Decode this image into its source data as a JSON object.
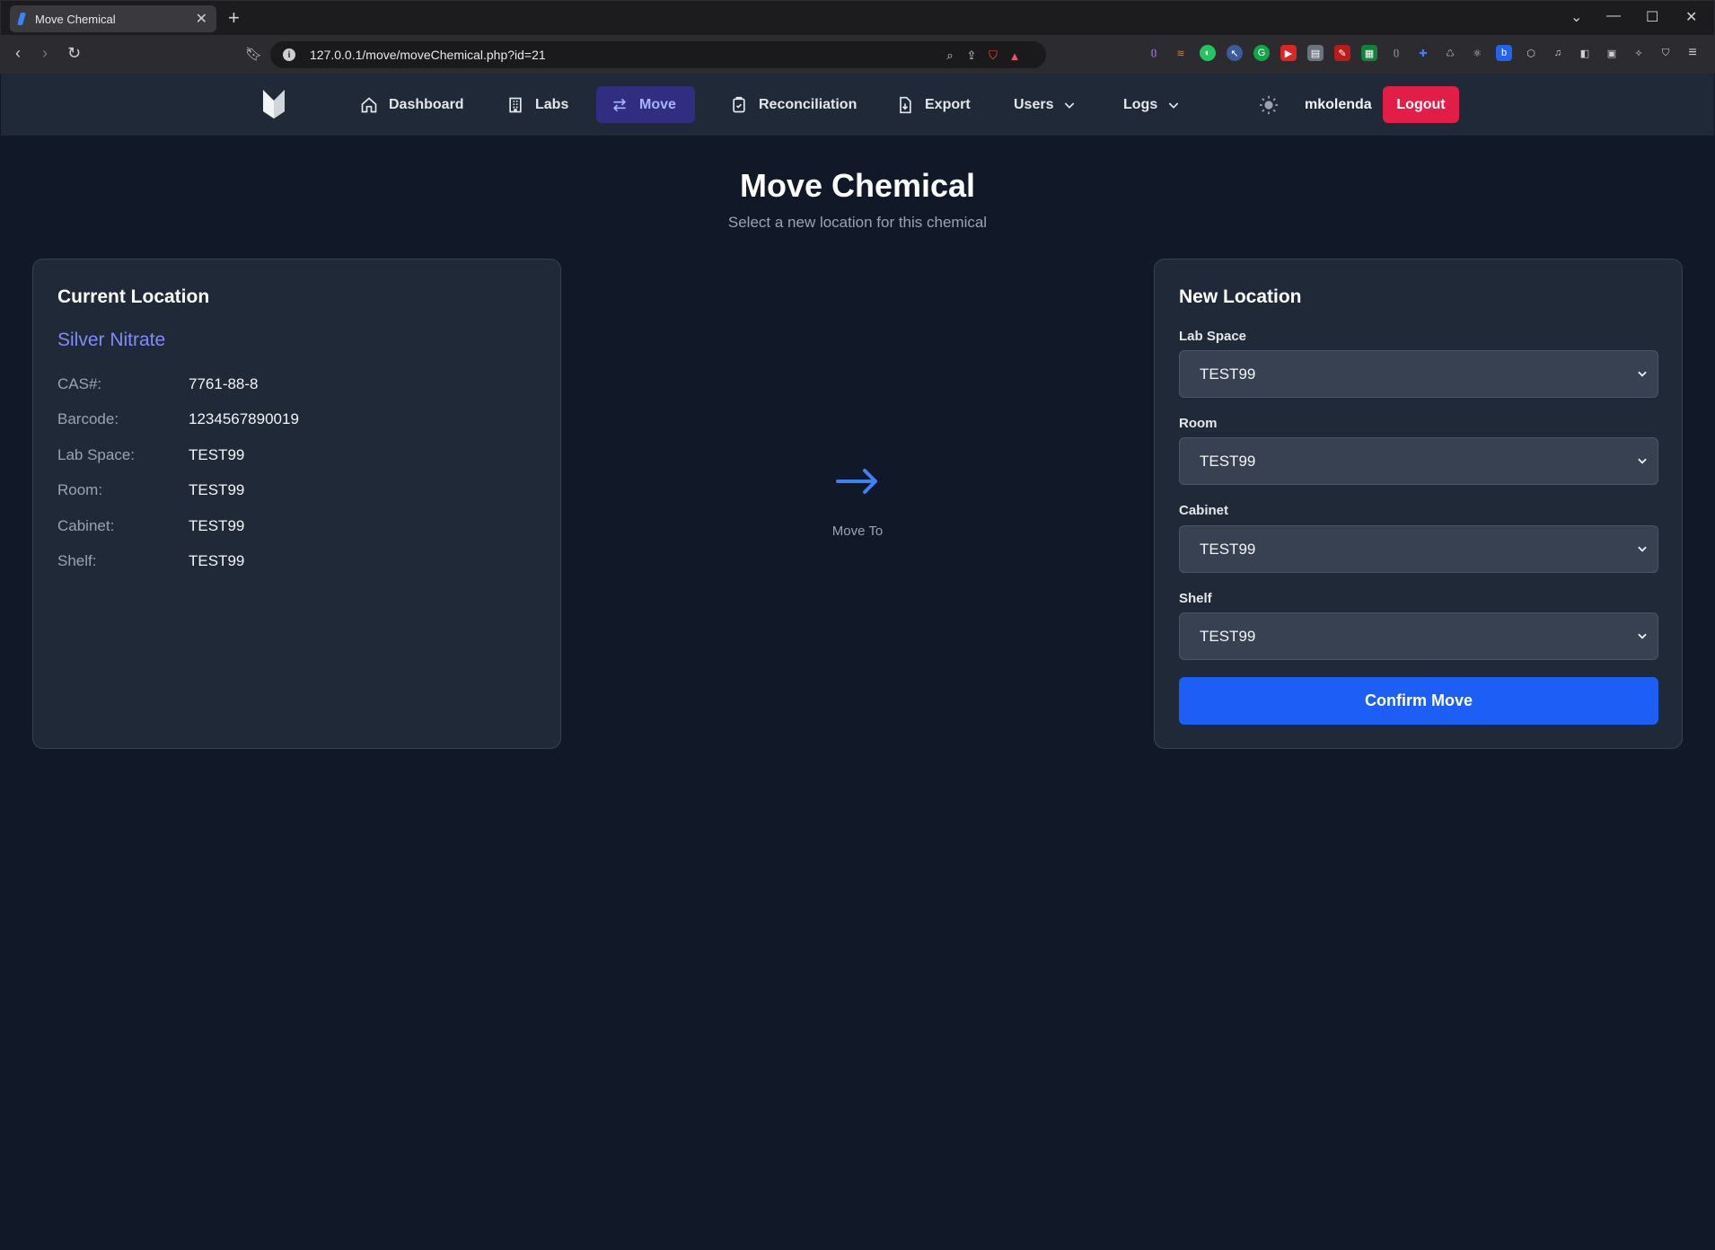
{
  "browser": {
    "tab_title": "Move Chemical",
    "url": "127.0.0.1/move/moveChemical.php?id=21"
  },
  "nav": {
    "items": [
      {
        "label": "Dashboard"
      },
      {
        "label": "Labs"
      },
      {
        "label": "Move"
      },
      {
        "label": "Reconciliation"
      },
      {
        "label": "Export"
      },
      {
        "label": "Users"
      },
      {
        "label": "Logs"
      }
    ],
    "username": "mkolenda",
    "logout_label": "Logout"
  },
  "page": {
    "title": "Move Chemical",
    "subtitle": "Select a new location for this chemical"
  },
  "current": {
    "heading": "Current Location",
    "chemical_name": "Silver Nitrate",
    "rows": [
      {
        "label": "CAS#:",
        "value": "7761-88-8"
      },
      {
        "label": "Barcode:",
        "value": "1234567890019"
      },
      {
        "label": "Lab Space:",
        "value": "TEST99"
      },
      {
        "label": "Room:",
        "value": "TEST99"
      },
      {
        "label": "Cabinet:",
        "value": "TEST99"
      },
      {
        "label": "Shelf:",
        "value": "TEST99"
      }
    ]
  },
  "middle": {
    "label": "Move To"
  },
  "new_location": {
    "heading": "New Location",
    "fields": [
      {
        "label": "Lab Space",
        "selected": "TEST99"
      },
      {
        "label": "Room",
        "selected": "TEST99"
      },
      {
        "label": "Cabinet",
        "selected": "TEST99"
      },
      {
        "label": "Shelf",
        "selected": "TEST99"
      }
    ],
    "confirm_label": "Confirm Move"
  },
  "colors": {
    "background": "#111827",
    "card": "#1f2937",
    "accent": "#1d5ff6",
    "chemical_name": "#818cf8",
    "logout": "#e11d48",
    "nav_active": "#312e81"
  }
}
